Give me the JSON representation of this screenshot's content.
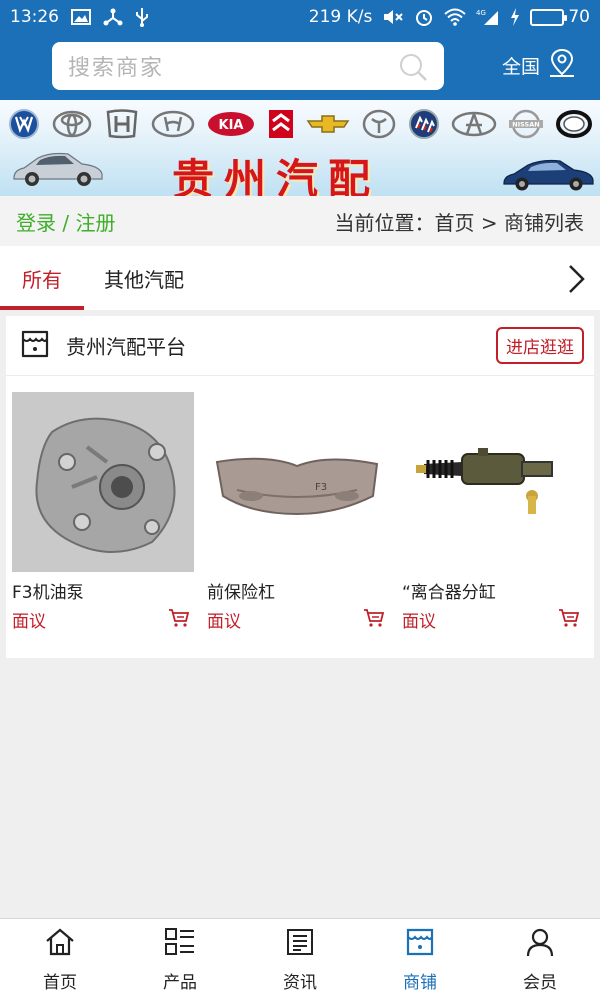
{
  "status_bar": {
    "time": "13:26",
    "speed": "219 K/s",
    "network": "4G",
    "battery": "70",
    "battery_level": 0.7
  },
  "header": {
    "search_placeholder": "搜索商家",
    "region": "全国"
  },
  "banner": {
    "title": "贵州汽配",
    "brand_logos": [
      "VW",
      "TOYOTA",
      "HONDA",
      "HYUNDAI",
      "KIA",
      "CITROEN",
      "CHEVROLET",
      "FAW",
      "BUICK",
      "CHERY",
      "NISSAN",
      "BYD"
    ]
  },
  "crumb": {
    "login": "登录 / 注册",
    "location": "当前位置：首页 > 商铺列表"
  },
  "tabs": [
    {
      "label": "所有",
      "active": true
    },
    {
      "label": "其他汽配",
      "active": false
    }
  ],
  "shop": {
    "name": "贵州汽配平台",
    "visit_label": "进店逛逛",
    "products": [
      {
        "name": "F3机油泵",
        "price": "面议"
      },
      {
        "name": "前保险杠",
        "price": "面议"
      },
      {
        "name": "“离合器分缸",
        "price": "面议"
      }
    ]
  },
  "bottom_nav": [
    {
      "label": "首页",
      "icon": "home-icon",
      "active": false
    },
    {
      "label": "产品",
      "icon": "grid-list-icon",
      "active": false
    },
    {
      "label": "资讯",
      "icon": "news-icon",
      "active": false
    },
    {
      "label": "商铺",
      "icon": "store-icon",
      "active": true
    },
    {
      "label": "会员",
      "icon": "user-icon",
      "active": false
    }
  ],
  "colors": {
    "primary_blue": "#1b70b8",
    "accent_red": "#c1202a",
    "login_green": "#3fae2a"
  }
}
